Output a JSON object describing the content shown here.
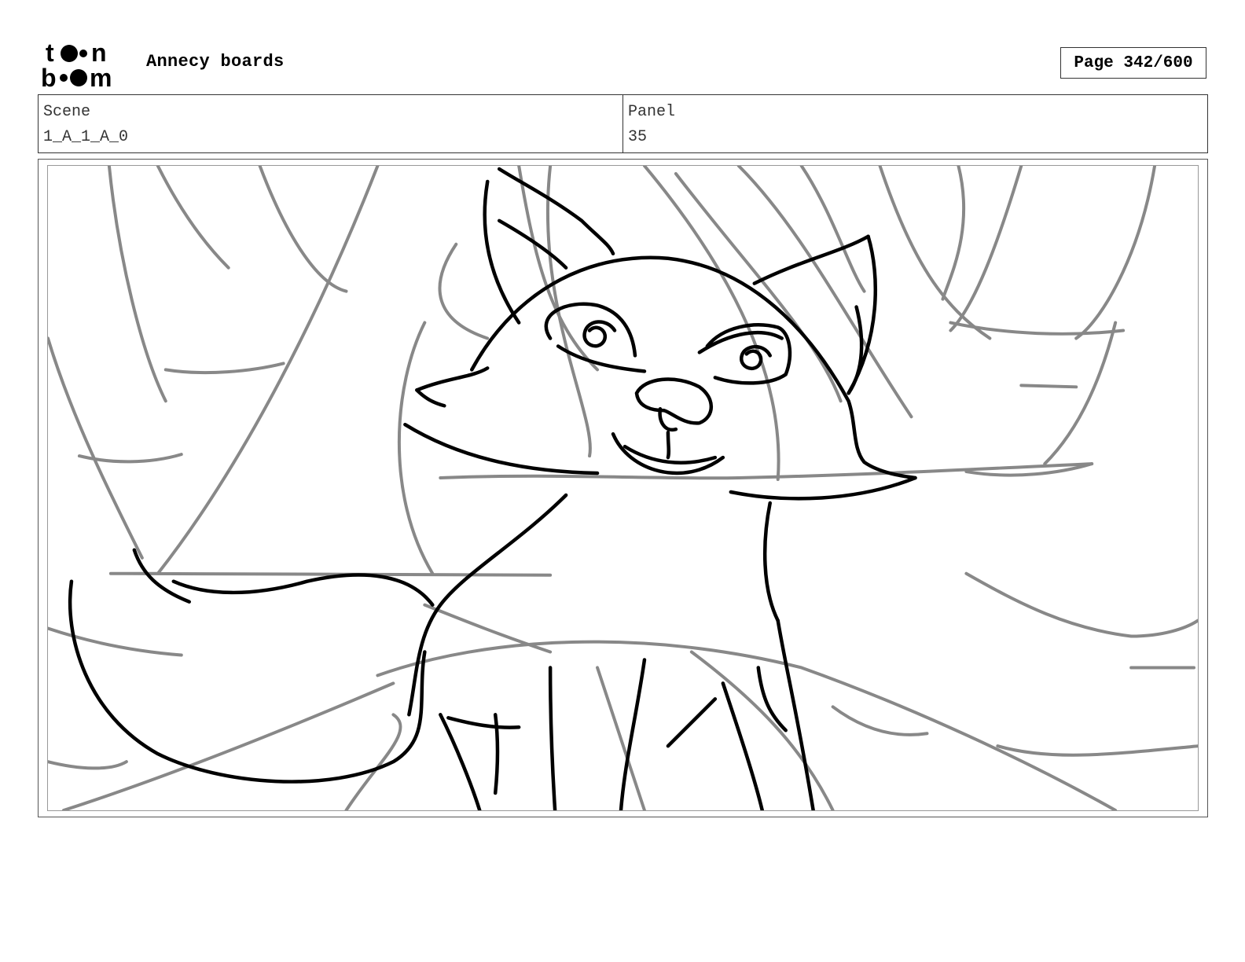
{
  "header": {
    "logo_text": "toon boom",
    "title": "Annecy boards",
    "page_label": "Page 342/600"
  },
  "info": {
    "scene_label": "Scene",
    "scene_value": "1_A_1_A_0",
    "panel_label": "Panel",
    "panel_value": "35"
  },
  "panel_image": {
    "icon": "storyboard-sketch-fox-in-forest"
  }
}
